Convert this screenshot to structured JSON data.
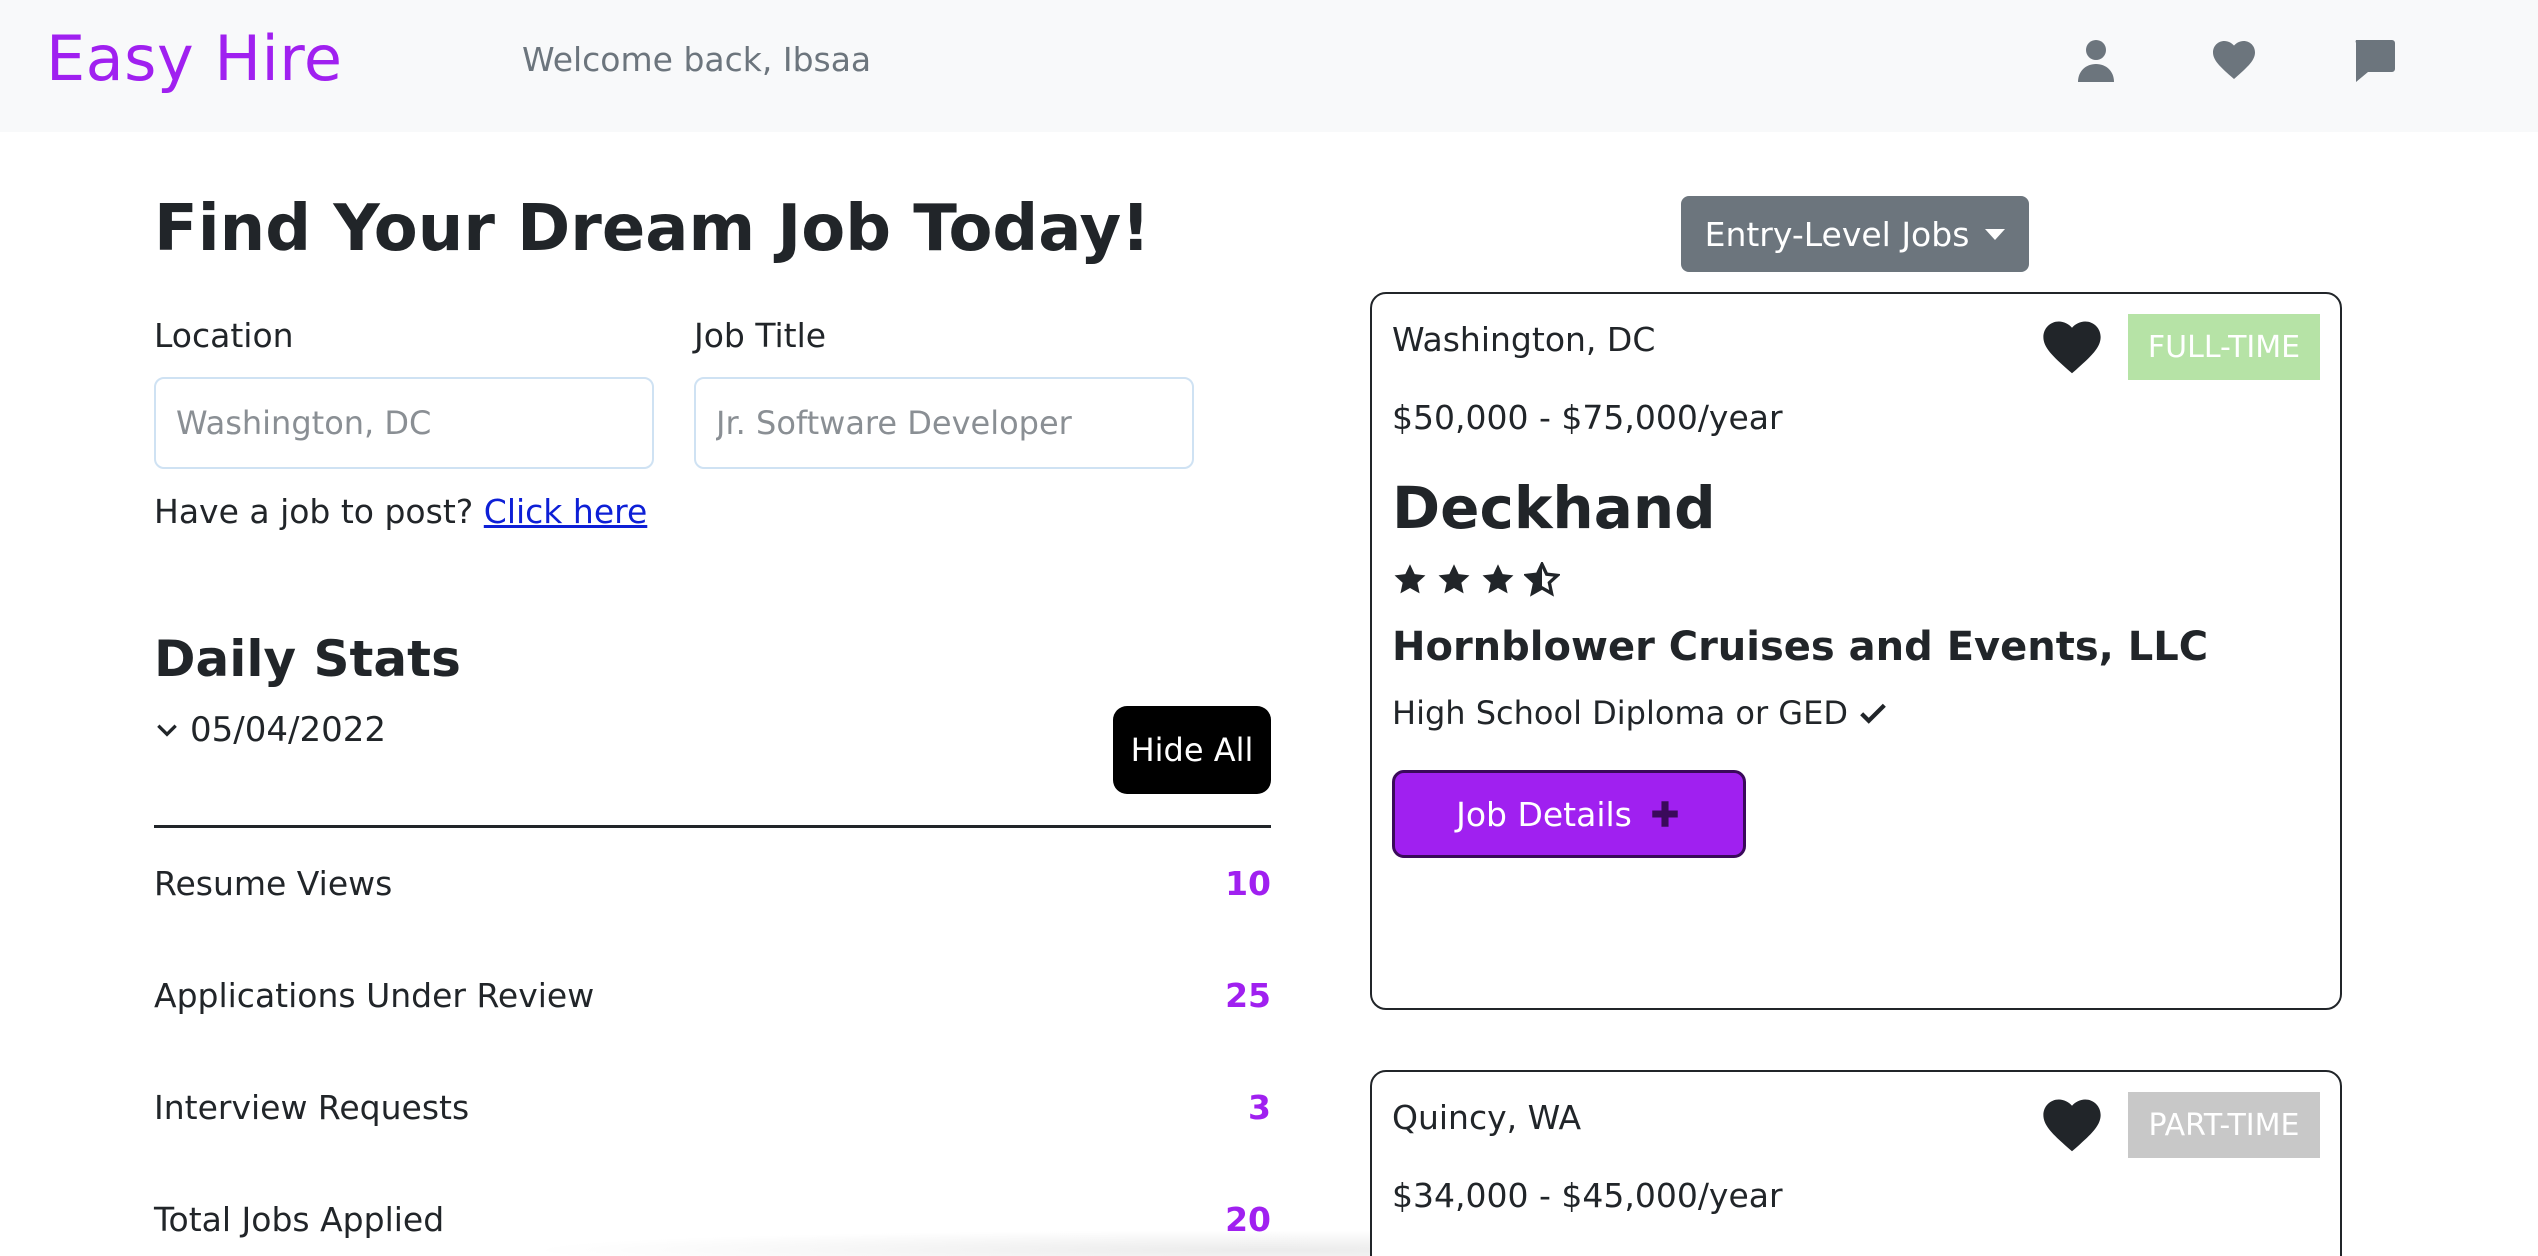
{
  "nav": {
    "brand": "Easy Hire",
    "welcome": "Welcome back, Ibsaa",
    "icons": [
      "user-icon",
      "heart-icon",
      "message-icon"
    ]
  },
  "search": {
    "heading": "Find Your Dream Job Today!",
    "location_label": "Location",
    "location_placeholder": "Washington, DC",
    "title_label": "Job Title",
    "title_placeholder": "Jr. Software Developer",
    "post_prompt": "Have a job to post?",
    "post_link": "Click here"
  },
  "stats": {
    "title": "Daily Stats",
    "date": "05/04/2022",
    "hide_button": "Hide All",
    "rows": [
      {
        "label": "Resume Views",
        "value": "10"
      },
      {
        "label": "Applications Under Review",
        "value": "25"
      },
      {
        "label": "Interview Requests",
        "value": "3"
      },
      {
        "label": "Total Jobs Applied",
        "value": "20"
      }
    ]
  },
  "filter": {
    "selected": "Entry-Level Jobs"
  },
  "jobs": [
    {
      "location": "Washington, DC",
      "type": "FULL-TIME",
      "type_color": "#b6e3a6",
      "salary": "$50,000 - $75,000/year",
      "title": "Deckhand",
      "rating": 3.5,
      "company": "Hornblower Cruises and Events, LLC",
      "requirement": "High School Diploma or GED",
      "details_button": "Job Details"
    },
    {
      "location": "Quincy, WA",
      "type": "PART-TIME",
      "type_color": "#c8c8c8",
      "salary": "$34,000 - $45,000/year"
    }
  ],
  "colors": {
    "brand": "#a020f0",
    "navbar_bg": "#f8f9fa",
    "dropdown_bg": "#6c757d"
  }
}
